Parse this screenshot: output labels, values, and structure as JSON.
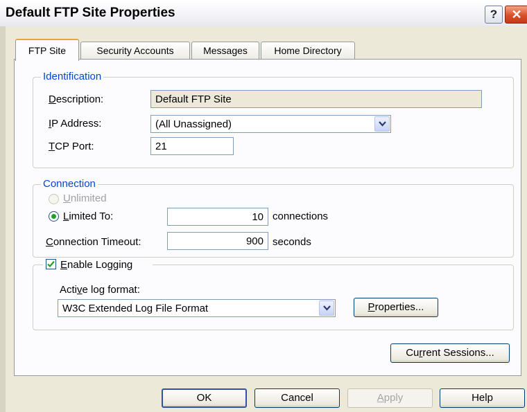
{
  "window": {
    "title": "Default FTP Site Properties",
    "help_glyph": "?",
    "close_glyph": "✕"
  },
  "tabs": [
    {
      "label": "FTP Site",
      "active": true
    },
    {
      "label": "Security Accounts",
      "active": false
    },
    {
      "label": "Messages",
      "active": false
    },
    {
      "label": "Home Directory",
      "active": false
    }
  ],
  "identification": {
    "legend": "Identification",
    "description_label": "Description:",
    "description_value": "Default FTP Site",
    "ip_label": "IP Address:",
    "ip_value": "(All Unassigned)",
    "port_label": "TCP Port:",
    "port_value": "21"
  },
  "connection": {
    "legend": "Connection",
    "unlimited_label": "Unlimited",
    "limited_label": "Limited To:",
    "limited_value": "10",
    "limited_unit": "connections",
    "timeout_label": "Connection Timeout:",
    "timeout_value": "900",
    "timeout_unit": "seconds"
  },
  "logging": {
    "checkbox_label": "Enable Logging",
    "checked": true,
    "format_label": "Active log format:",
    "format_value": "W3C Extended Log File Format",
    "properties_button": "Properties..."
  },
  "current_sessions_button": "Current Sessions...",
  "buttons": {
    "ok": "OK",
    "cancel": "Cancel",
    "apply": "Apply",
    "help": "Help"
  },
  "colors": {
    "legend": "#0046d5",
    "dialog_bg": "#ece9d8",
    "panel_bg": "#fcfcfe",
    "radio_dot": "#21a121"
  }
}
